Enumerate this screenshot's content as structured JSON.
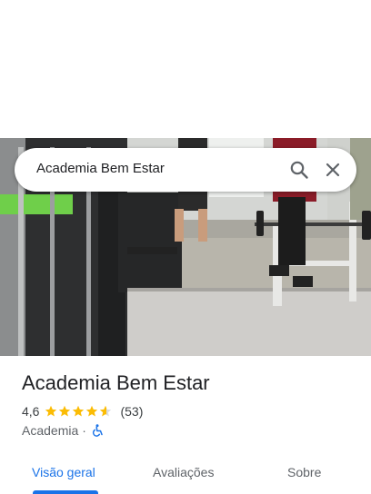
{
  "search": {
    "query": "Academia Bem Estar",
    "search_icon": "search-icon",
    "close_icon": "close-icon"
  },
  "photo": {
    "description_icon": "gym-photo"
  },
  "place": {
    "title": "Academia Bem Estar",
    "rating": "4,6",
    "rating_value": 4.6,
    "stars_max": 5,
    "reviews": "(53)",
    "category": "Academia",
    "separator": "·",
    "accessibility_icon": "wheelchair-icon"
  },
  "tabs": [
    {
      "label": "Visão geral",
      "active": true
    },
    {
      "label": "Avaliações",
      "active": false
    },
    {
      "label": "Sobre",
      "active": false
    }
  ],
  "colors": {
    "accent": "#1a73e8",
    "star": "#fbbc04",
    "star_empty": "#dadce0"
  }
}
